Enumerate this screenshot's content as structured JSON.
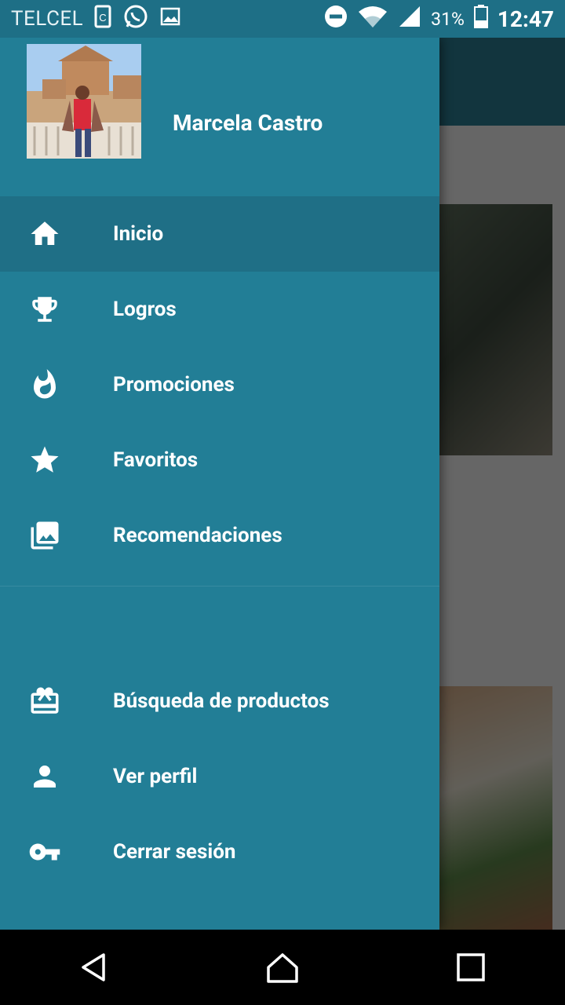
{
  "status_bar": {
    "carrier": "TELCEL",
    "battery": "31%",
    "time": "12:47"
  },
  "drawer": {
    "user_name": "Marcela Castro",
    "items_primary": [
      {
        "label": "Inicio",
        "icon": "home-icon",
        "active": true
      },
      {
        "label": "Logros",
        "icon": "trophy-icon"
      },
      {
        "label": "Promociones",
        "icon": "flame-icon"
      },
      {
        "label": "Favoritos",
        "icon": "star-icon"
      },
      {
        "label": "Recomendaciones",
        "icon": "photo-library-icon"
      }
    ],
    "items_secondary": [
      {
        "label": "Búsqueda de productos",
        "icon": "gift-card-icon"
      },
      {
        "label": "Ver perfil",
        "icon": "person-icon"
      },
      {
        "label": "Cerrar sesión",
        "icon": "key-icon"
      }
    ]
  },
  "colors": {
    "drawer_bg": "#227e96",
    "active_item_bg": "#1f6f86",
    "status_bar_bg": "#1e6f86"
  }
}
